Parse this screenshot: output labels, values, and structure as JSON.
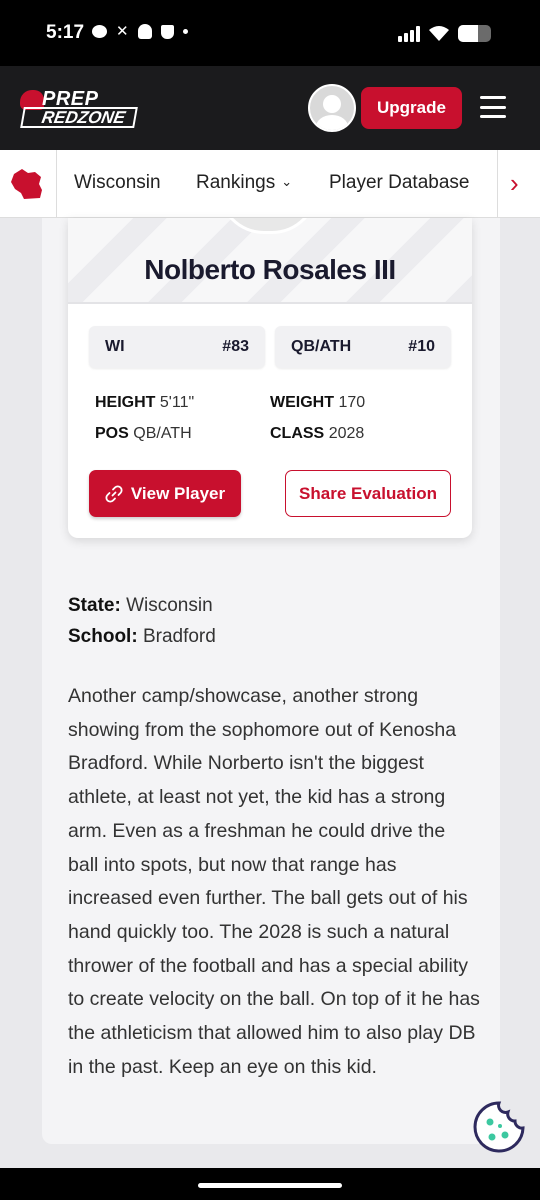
{
  "status_bar": {
    "time": "5:17",
    "battery_level": 0.62
  },
  "header": {
    "logo_top": "PREP",
    "logo_bottom": "REDZONE",
    "upgrade_label": "Upgrade",
    "accent_color": "#c8102e"
  },
  "subnav": {
    "items": [
      "Wisconsin",
      "Rankings",
      "Player Database"
    ]
  },
  "player": {
    "name": "Nolberto Rosales III",
    "state_code": "WI",
    "state_rank": "#83",
    "position_code": "QB/ATH",
    "position_rank": "#10",
    "height_label": "HEIGHT",
    "height": "5'11\"",
    "weight_label": "WEIGHT",
    "weight": "170",
    "pos_label": "POS",
    "pos": "QB/ATH",
    "class_label": "CLASS",
    "class_year": "2028",
    "view_label": "View Player",
    "share_label": "Share Evaluation"
  },
  "details": {
    "state_label": "State:",
    "state_value": "Wisconsin",
    "school_label": "School:",
    "school_value": "Bradford"
  },
  "evaluation": "Another camp/showcase, another strong showing from the sophomore out of Kenosha Bradford. While Norberto isn't the biggest athlete, at least not yet, the kid has a strong arm. Even as a freshman he could drive the ball into spots, but now that range has increased even further. The ball gets out of his hand quickly too. The 2028 is such a natural thrower of the football and has a special ability to create velocity on the ball. On top of it he has the athleticism that allowed him to also play DB in the past. Keep an eye on this kid."
}
